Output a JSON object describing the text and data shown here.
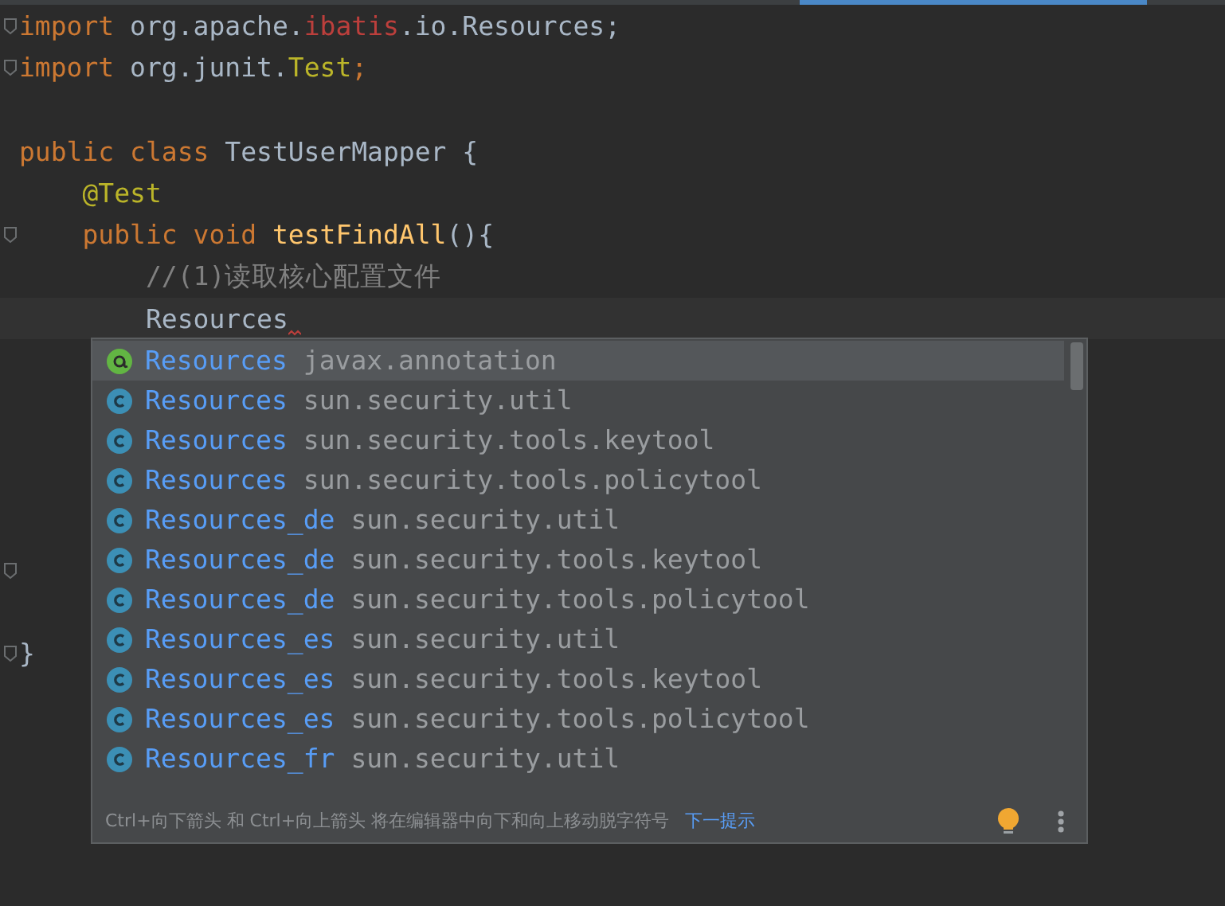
{
  "editor": {
    "lines": [
      {
        "fold": true,
        "current": false,
        "tokens": [
          {
            "kind": "keyword",
            "text": "import "
          },
          {
            "kind": "plain",
            "text": "org.apache."
          },
          {
            "kind": "error",
            "text": "ibatis"
          },
          {
            "kind": "plain",
            "text": ".io.Resources;"
          }
        ]
      },
      {
        "fold": true,
        "current": false,
        "tokens": [
          {
            "kind": "keyword",
            "text": "import "
          },
          {
            "kind": "plain",
            "text": "org.junit."
          },
          {
            "kind": "annotation",
            "text": "Test"
          },
          {
            "kind": "keyword",
            "text": ";"
          }
        ]
      },
      {
        "fold": false,
        "current": false
      },
      {
        "fold": false,
        "current": false,
        "tokens": [
          {
            "kind": "keyword",
            "text": "public class "
          },
          {
            "kind": "plain",
            "text": "TestUserMapper {"
          }
        ]
      },
      {
        "fold": false,
        "current": false,
        "tokens": [
          {
            "kind": "annotation",
            "text": "    @Test"
          }
        ]
      },
      {
        "fold": true,
        "current": false,
        "tokens": [
          {
            "kind": "keyword",
            "text": "    public void "
          },
          {
            "kind": "method",
            "text": "testFindAll"
          },
          {
            "kind": "plain",
            "text": "(){"
          }
        ]
      },
      {
        "fold": false,
        "current": false,
        "tokens": [
          {
            "kind": "comment",
            "text": "        //(1)读取核心配置文件"
          }
        ]
      },
      {
        "fold": false,
        "current": true,
        "tokens": [
          {
            "kind": "plain",
            "text": "        Resources"
          }
        ]
      },
      {
        "fold": false,
        "current": false
      },
      {
        "fold": false,
        "current": false
      },
      {
        "fold": false,
        "current": false
      },
      {
        "fold": false,
        "current": false
      },
      {
        "fold": false,
        "current": false
      },
      {
        "fold": true,
        "current": false
      },
      {
        "fold": false,
        "current": false
      },
      {
        "fold": true,
        "current": false,
        "tokens": [
          {
            "kind": "plain",
            "text": "}"
          }
        ]
      }
    ]
  },
  "completion": {
    "items": [
      {
        "kind": "annotation",
        "selected": true,
        "name": "Resources",
        "package": "javax.annotation"
      },
      {
        "kind": "class",
        "selected": false,
        "name": "Resources",
        "package": "sun.security.util"
      },
      {
        "kind": "class",
        "selected": false,
        "name": "Resources",
        "package": "sun.security.tools.keytool"
      },
      {
        "kind": "class",
        "selected": false,
        "name": "Resources",
        "package": "sun.security.tools.policytool"
      },
      {
        "kind": "class",
        "selected": false,
        "name": "Resources_de",
        "package": "sun.security.util"
      },
      {
        "kind": "class",
        "selected": false,
        "name": "Resources_de",
        "package": "sun.security.tools.keytool"
      },
      {
        "kind": "class",
        "selected": false,
        "name": "Resources_de",
        "package": "sun.security.tools.policytool"
      },
      {
        "kind": "class",
        "selected": false,
        "name": "Resources_es",
        "package": "sun.security.util"
      },
      {
        "kind": "class",
        "selected": false,
        "name": "Resources_es",
        "package": "sun.security.tools.keytool"
      },
      {
        "kind": "class",
        "selected": false,
        "name": "Resources_es",
        "package": "sun.security.tools.policytool"
      },
      {
        "kind": "class",
        "selected": false,
        "name": "Resources_fr",
        "package": "sun.security.util"
      }
    ],
    "footer": {
      "hint": "Ctrl+向下箭头 和 Ctrl+向上箭头 将在编辑器中向下和向上移动脱字符号",
      "link": "下一提示"
    }
  }
}
